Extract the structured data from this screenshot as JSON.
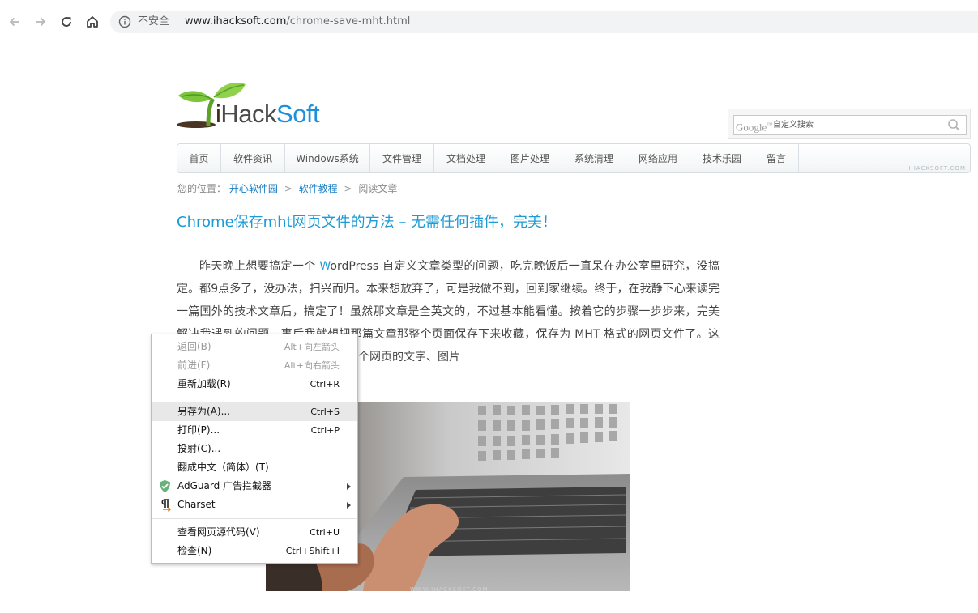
{
  "browser": {
    "security_label": "不安全",
    "url_host": "www.ihacksoft.com",
    "url_path": "/chrome-save-mht.html",
    "icons": [
      "back-icon",
      "forward-icon",
      "reload-icon",
      "home-icon",
      "info-icon"
    ]
  },
  "site": {
    "logo": {
      "i": "i",
      "hack": "Hack",
      "soft": "Soft"
    },
    "search": {
      "google": "Google",
      "tm": "™",
      "placeholder": "自定义搜索"
    },
    "nav": [
      "首页",
      "软件资讯",
      "Windows系统",
      "文件管理",
      "文档处理",
      "图片处理",
      "系统清理",
      "网络应用",
      "技术乐园",
      "留言"
    ],
    "nav_watermark": "IHACKSOFT.COM",
    "breadcrumb": {
      "prefix": "您的位置：",
      "home": "开心软件园",
      "sep": ">",
      "category": "软件教程",
      "current": "阅读文章"
    }
  },
  "article": {
    "title": "Chrome保存mht网页文件的方法 – 无需任何插件，完美！",
    "para_start": "昨天晚上想要搞定一个 ",
    "wordpress_w": "W",
    "wordpress_rest": "ordPress",
    "para_rest": " 自定义文章类型的问题，吃完晚饭后一直呆在办公室里研究，没搞定。都9点多了，没办法，扫兴而归。本来想放弃了，可是我做不到，回到家继续。终于，在我静下心来读完一篇国外的技术文章后，搞定了！虽然那文章是全英文的，不过基本能看懂。按着它的步骤一步步来，完美解决我遇到的问题。事后我就想把那篇文章那整个页面保存下来收藏，保存为 MHT 格式的网页文件了。这是一种聚合网页文件，它可以包括整个网页的文字、图片"
  },
  "context_menu": {
    "items": [
      {
        "label": "返回(B)",
        "shortcut": "Alt+向左箭头",
        "disabled": true
      },
      {
        "label": "前进(F)",
        "shortcut": "Alt+向右箭头",
        "disabled": true
      },
      {
        "label": "重新加载(R)",
        "shortcut": "Ctrl+R",
        "disabled": false
      },
      {
        "label": "另存为(A)...",
        "shortcut": "Ctrl+S",
        "disabled": false,
        "highlighted": true
      },
      {
        "label": "打印(P)...",
        "shortcut": "Ctrl+P",
        "disabled": false
      },
      {
        "label": "投射(C)...",
        "shortcut": "",
        "disabled": false
      },
      {
        "label": "翻成中文（简体）(T)",
        "shortcut": "",
        "disabled": false
      },
      {
        "label": "AdGuard 广告拦截器",
        "shortcut": "",
        "submenu": true,
        "icon": "adguard-shield-icon"
      },
      {
        "label": "Charset",
        "shortcut": "",
        "submenu": true,
        "icon": "charset-pilcrow-icon"
      },
      {
        "label": "查看网页源代码(V)",
        "shortcut": "Ctrl+U",
        "disabled": false
      },
      {
        "label": "检查(N)",
        "shortcut": "Ctrl+Shift+I",
        "disabled": false
      }
    ]
  },
  "colors": {
    "link_blue": "#1b9ad6",
    "text_gray": "#444444",
    "menu_disabled": "#9a9a9a",
    "menu_highlight": "#e8e8e8"
  }
}
